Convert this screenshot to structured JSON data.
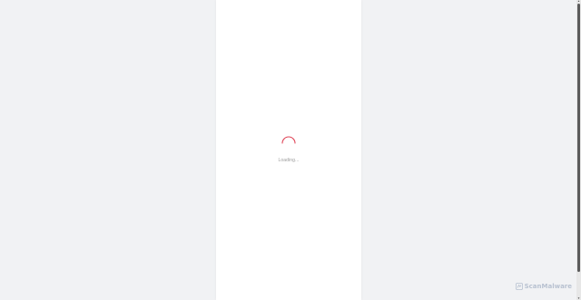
{
  "loader": {
    "text": "Loading..."
  },
  "watermark": {
    "text": "ScanMalware"
  },
  "colors": {
    "background": "#f1f2f4",
    "panel": "#ffffff",
    "spinner_accent": "#e0485a",
    "loading_text": "#9a9a9a"
  },
  "icons": {
    "spinner": "loading-spinner-icon",
    "watermark_logo": "scanmalware-logo-icon"
  }
}
